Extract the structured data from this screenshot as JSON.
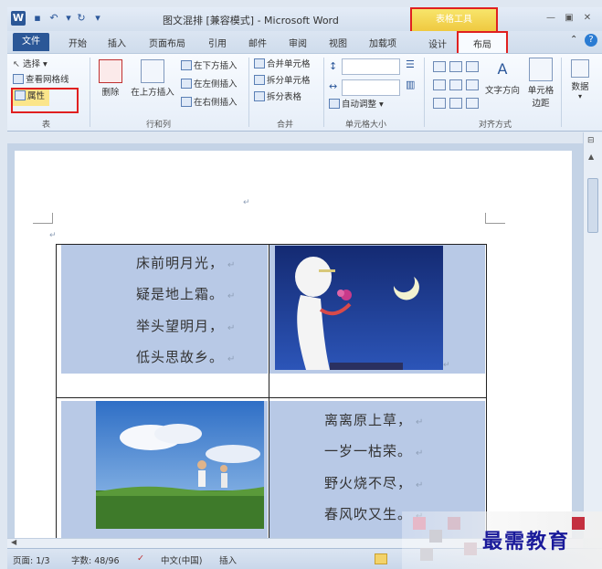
{
  "window": {
    "title": "图文混排 [兼容模式] - Microsoft Word",
    "contextual_tab_group": "表格工具"
  },
  "tabs": {
    "file": "文件",
    "items": [
      "开始",
      "插入",
      "页面布局",
      "引用",
      "邮件",
      "审阅",
      "视图",
      "加载项"
    ],
    "design": "设计",
    "layout": "布局"
  },
  "ribbon": {
    "table_group": {
      "select": "选择 ▾",
      "view_gridlines": "查看网格线",
      "properties": "属性",
      "label": "表"
    },
    "rows_cols_group": {
      "delete": "删除",
      "insert_above": "在上方插入",
      "insert_below": "在下方插入",
      "insert_left": "在左侧插入",
      "insert_right": "在右侧插入",
      "label": "行和列"
    },
    "merge_group": {
      "merge_cells": "合并单元格",
      "split_cells": "拆分单元格",
      "split_table": "拆分表格",
      "label": "合并"
    },
    "cell_size_group": {
      "autofit": "自动调整 ▾",
      "label": "单元格大小"
    },
    "alignment_group": {
      "text_direction": "文字方向",
      "cell_margins_1": "单元格",
      "cell_margins_2": "边距",
      "label": "对齐方式"
    },
    "data_group": {
      "data": "数据"
    }
  },
  "document": {
    "poem1": [
      "床前明月光，",
      "疑是地上霜。",
      "举头望明月，",
      "低头思故乡。"
    ],
    "poem2": [
      "离离原上草，",
      "一岁一枯荣。",
      "野火烧不尽，",
      "春风吹又生。"
    ]
  },
  "statusbar": {
    "page": "页面: 1/3",
    "words": "字数: 48/96",
    "language": "中文(中国)",
    "insert": "插入"
  },
  "watermark": "最需教育",
  "colors": {
    "accent": "#2b5797",
    "highlight_red": "#e02020",
    "table_tools": "#efc940",
    "cell_shading": "#b8c9e6"
  }
}
